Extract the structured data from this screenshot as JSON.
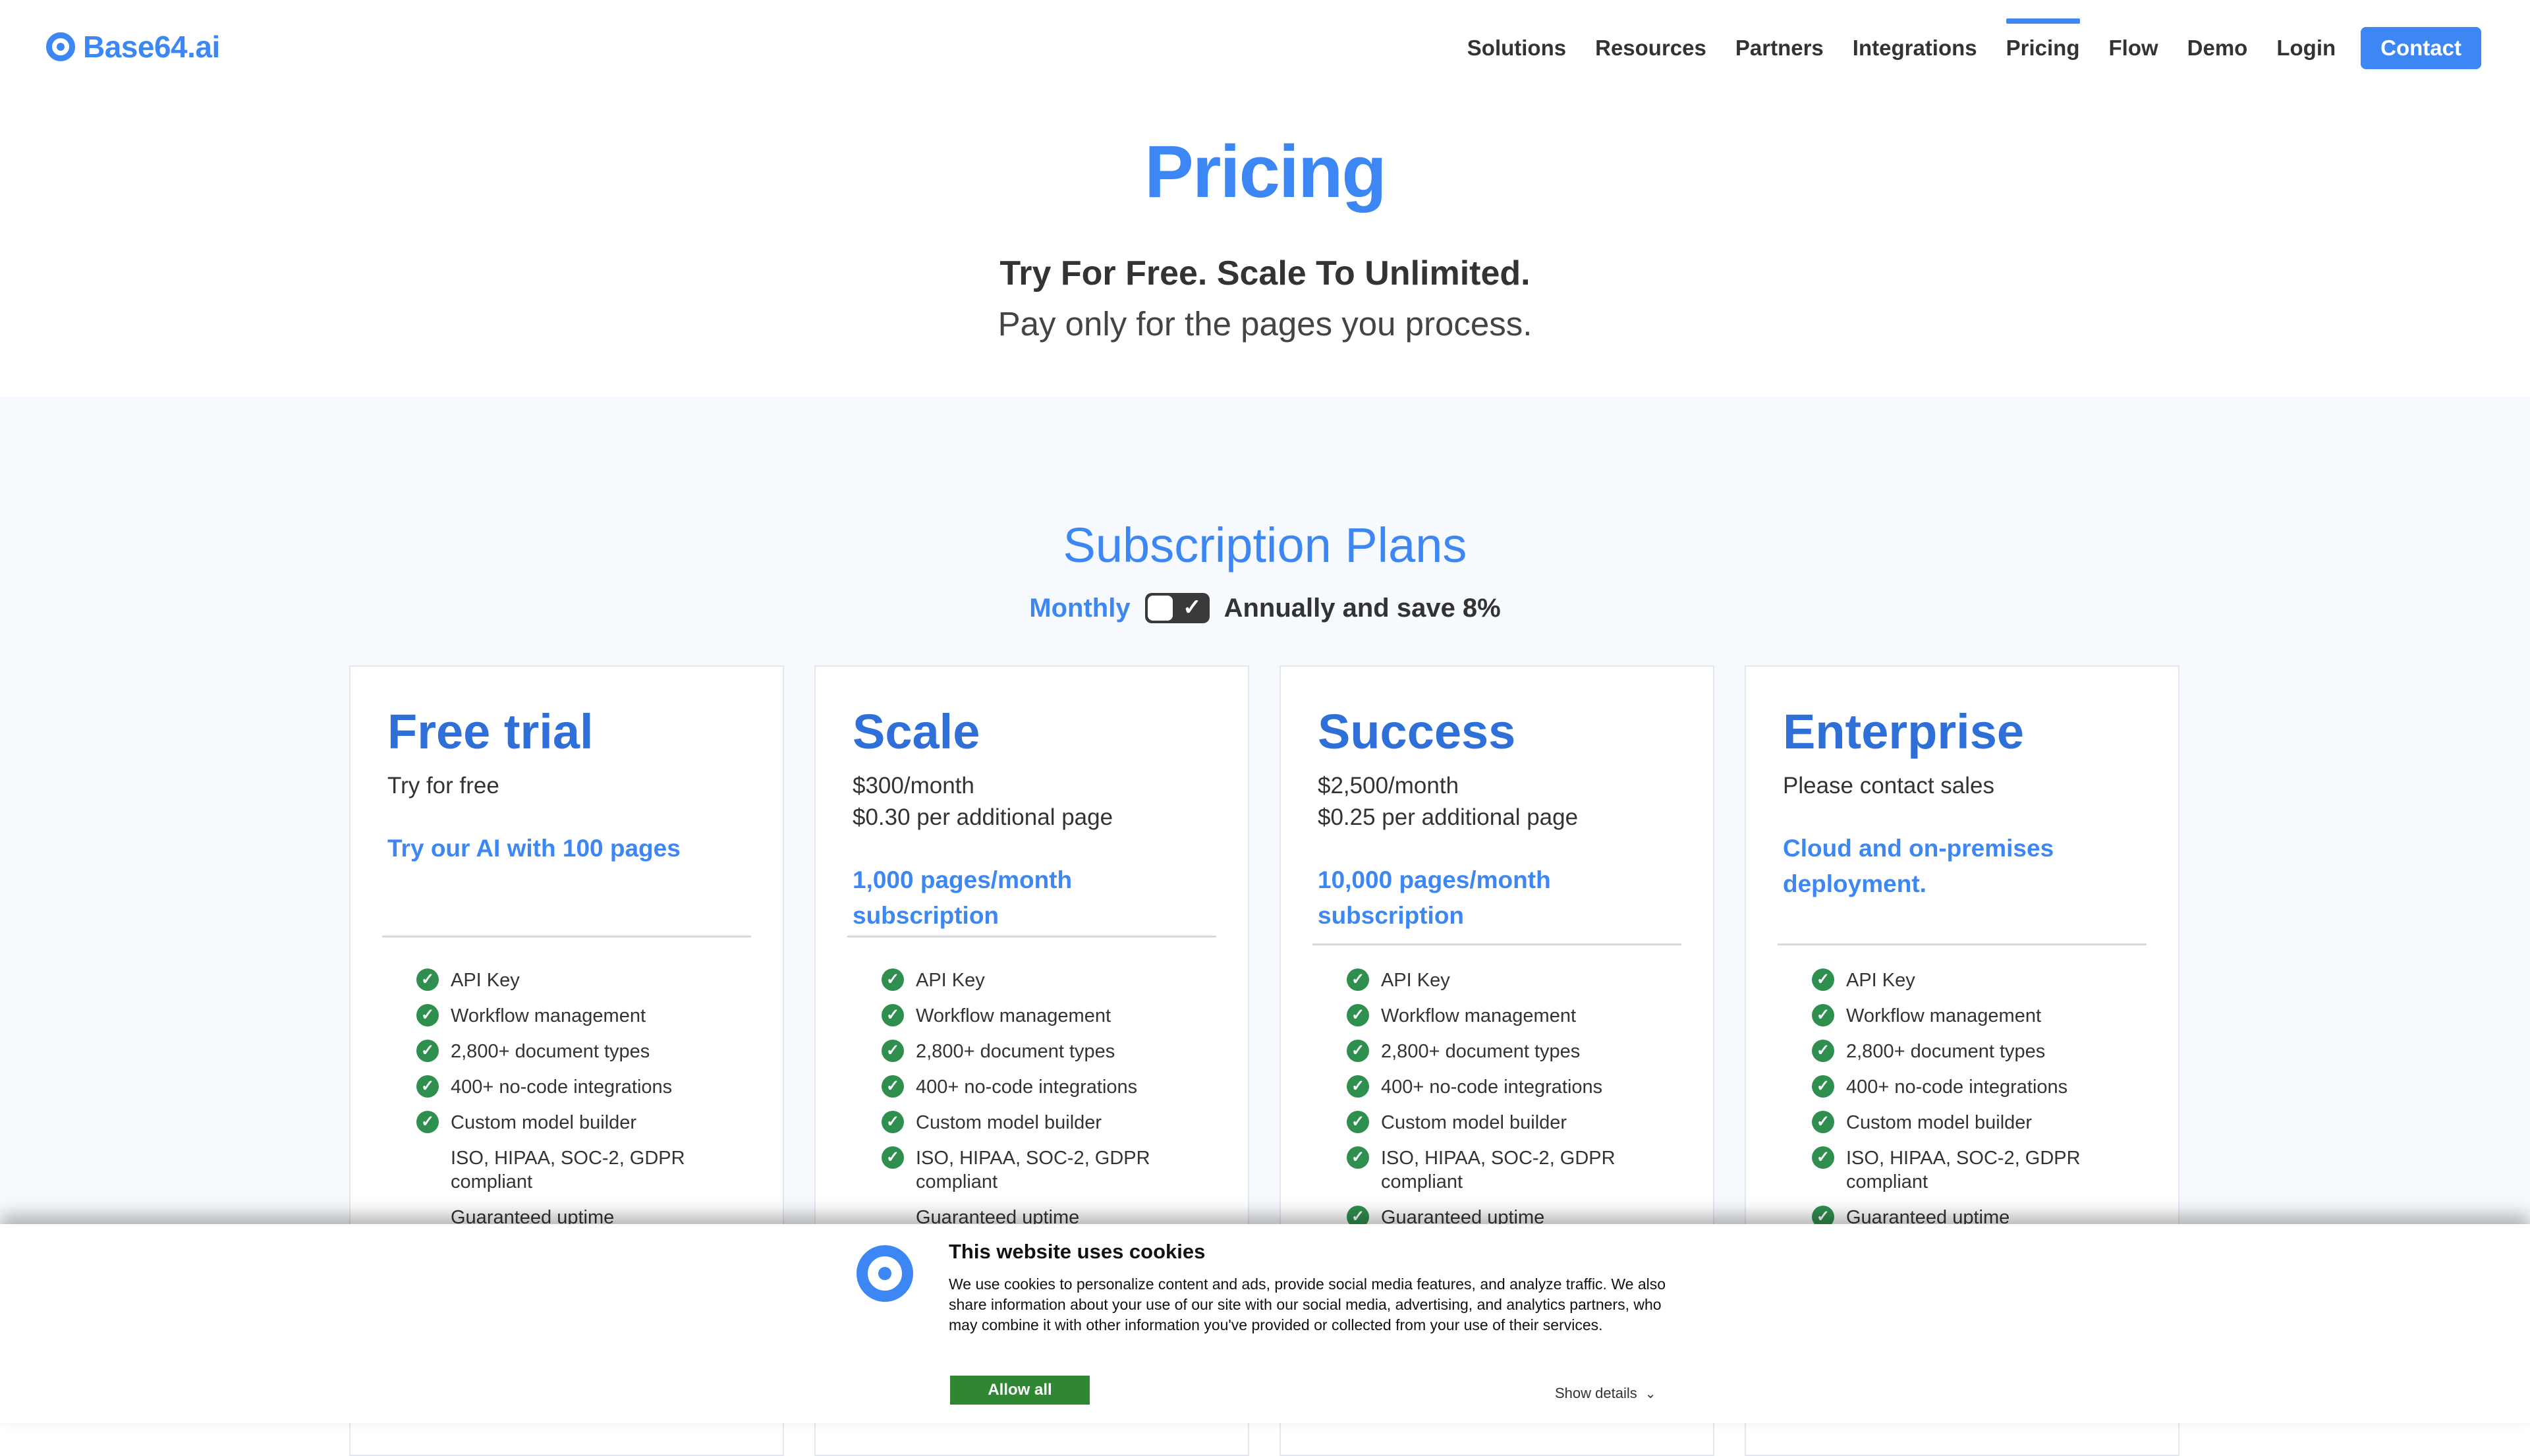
{
  "nav": {
    "logo_text": "Base64.ai",
    "links": [
      "Solutions",
      "Resources",
      "Partners",
      "Integrations",
      "Pricing",
      "Flow",
      "Demo",
      "Login"
    ],
    "contact_label": "Contact"
  },
  "hero": {
    "title": "Pricing",
    "tagline": "Try For Free. Scale To Unlimited.",
    "subtitle": "Pay only for the pages you process."
  },
  "plans": {
    "title": "Subscription Plans",
    "toggle": {
      "monthly_label": "Monthly",
      "annual_label": "Annually and save 8%",
      "checked": true
    },
    "cards": [
      {
        "name": "Free trial",
        "price_line1": "Try for free",
        "price_line2": "",
        "highlight": "Try our AI with 100 pages",
        "features": [
          {
            "text": "API Key",
            "check": true
          },
          {
            "text": "Workflow management",
            "check": true
          },
          {
            "text": "2,800+ document types",
            "check": true
          },
          {
            "text": "400+ no-code integrations",
            "check": true
          },
          {
            "text": "Custom model builder",
            "check": true
          },
          {
            "text": "ISO, HIPAA, SOC-2, GDPR compliant",
            "check": false
          },
          {
            "text": "Guaranteed uptime",
            "check": false
          }
        ]
      },
      {
        "name": "Scale",
        "price_line1": "$300/month",
        "price_line2": "$0.30 per additional page",
        "highlight": "1,000 pages/month subscription",
        "features": [
          {
            "text": "API Key",
            "check": true
          },
          {
            "text": "Workflow management",
            "check": true
          },
          {
            "text": "2,800+ document types",
            "check": true
          },
          {
            "text": "400+ no-code integrations",
            "check": true
          },
          {
            "text": "Custom model builder",
            "check": true
          },
          {
            "text": "ISO, HIPAA, SOC-2, GDPR compliant",
            "check": true
          },
          {
            "text": "Guaranteed uptime",
            "check": false
          }
        ]
      },
      {
        "name": "Success",
        "price_line1": "$2,500/month",
        "price_line2": "$0.25 per additional page",
        "highlight": "10,000 pages/month subscription",
        "features": [
          {
            "text": "API Key",
            "check": true
          },
          {
            "text": "Workflow management",
            "check": true
          },
          {
            "text": "2,800+ document types",
            "check": true
          },
          {
            "text": "400+ no-code integrations",
            "check": true
          },
          {
            "text": "Custom model builder",
            "check": true
          },
          {
            "text": "ISO, HIPAA, SOC-2, GDPR compliant",
            "check": true
          },
          {
            "text": "Guaranteed uptime",
            "check": true
          }
        ]
      },
      {
        "name": "Enterprise",
        "price_line1": "Please contact sales",
        "price_line2": "",
        "highlight": "Cloud and on-premises deployment.",
        "features": [
          {
            "text": "API Key",
            "check": true
          },
          {
            "text": "Workflow management",
            "check": true
          },
          {
            "text": "2,800+ document types",
            "check": true
          },
          {
            "text": "400+ no-code integrations",
            "check": true
          },
          {
            "text": "Custom model builder",
            "check": true
          },
          {
            "text": "ISO, HIPAA, SOC-2, GDPR compliant",
            "check": true
          },
          {
            "text": "Guaranteed uptime",
            "check": true
          }
        ]
      }
    ]
  },
  "cookie": {
    "title": "This website uses cookies",
    "text": "We use cookies to personalize content and ads, provide social media features, and analyze traffic. We also share information about your use of our site with our social media, advertising, and analytics partners, who may combine it with other information you've provided or collected from your use of their services.",
    "allow_label": "Allow all",
    "details_label": "Show details"
  },
  "colors": {
    "accent": "#3d87f5",
    "check": "#2f8f4e",
    "allow": "#2f8633"
  }
}
